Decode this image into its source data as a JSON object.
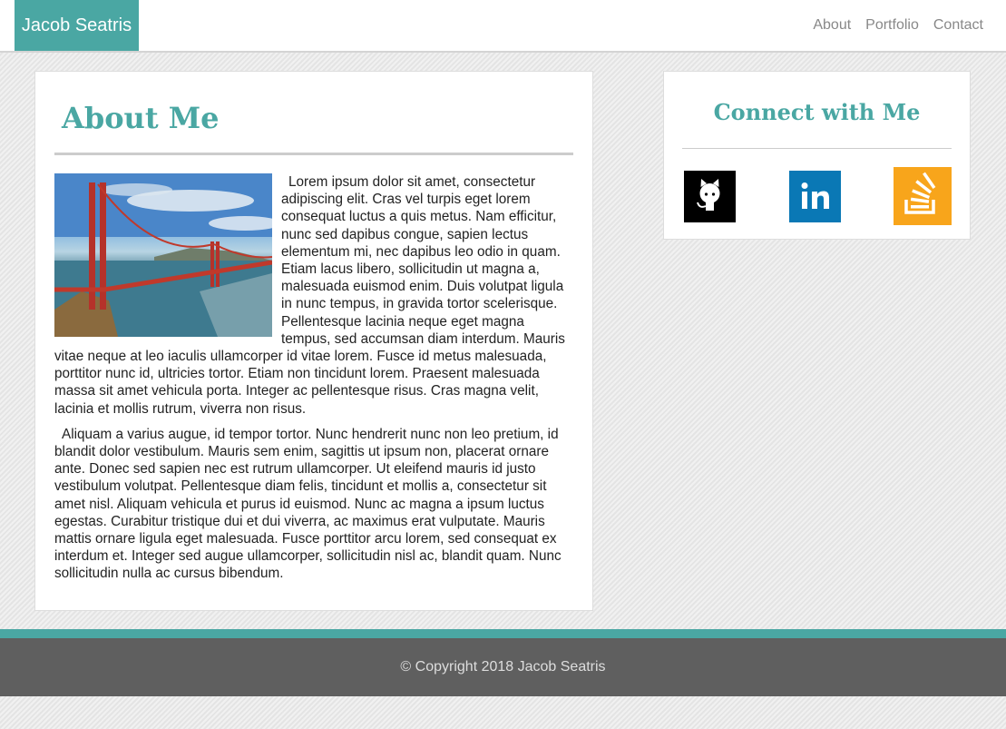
{
  "nav": {
    "brand": "Jacob Seatris",
    "links": [
      "About",
      "Portfolio",
      "Contact"
    ]
  },
  "about": {
    "title": "About Me",
    "image_alt": "Golden Gate Bridge",
    "paragraphs": [
      "Lorem ipsum dolor sit amet, consectetur adipiscing elit. Cras vel turpis eget lorem consequat luctus a quis metus. Nam efficitur, nunc sed dapibus congue, sapien lectus elementum mi, nec dapibus leo odio in quam. Etiam lacus libero, sollicitudin ut magna a, malesuada euismod enim. Duis volutpat ligula in nunc tempus, in gravida tortor scelerisque. Pellentesque lacinia neque eget magna tempus, sed accumsan diam interdum. Mauris vitae neque at leo iaculis ullamcorper id vitae lorem. Fusce id metus malesuada, porttitor nunc id, ultricies tortor. Etiam non tincidunt lorem. Praesent malesuada massa sit amet vehicula porta. Integer ac pellentesque risus. Cras magna velit, lacinia et mollis rutrum, viverra non risus.",
      "Aliquam a varius augue, id tempor tortor. Nunc hendrerit nunc non leo pretium, id blandit dolor vestibulum. Mauris sem enim, sagittis ut ipsum non, placerat ornare ante. Donec sed sapien nec est rutrum ullamcorper. Ut eleifend mauris id justo vestibulum volutpat. Pellentesque diam felis, tincidunt et mollis a, consectetur sit amet nisl. Aliquam vehicula et purus id euismod. Nunc ac magna a ipsum luctus egestas. Curabitur tristique dui et dui viverra, ac maximus erat vulputate. Mauris mattis ornare ligula eget malesuada. Fusce porttitor arcu lorem, sed consequat ex interdum et. Integer sed augue ullamcorper, sollicitudin nisl ac, blandit quam. Nunc sollicitudin nulla ac cursus bibendum."
    ]
  },
  "connect": {
    "title": "Connect with Me",
    "icons": [
      "github-icon",
      "linkedin-icon",
      "stackoverflow-icon"
    ]
  },
  "footer": {
    "copyright": "© Copyright 2018 Jacob Seatris"
  },
  "colors": {
    "accent": "#4aa7a3",
    "footer_bg": "#5f5f5f",
    "linkedin": "#0a78b5",
    "stackoverflow": "#f8a51b"
  }
}
